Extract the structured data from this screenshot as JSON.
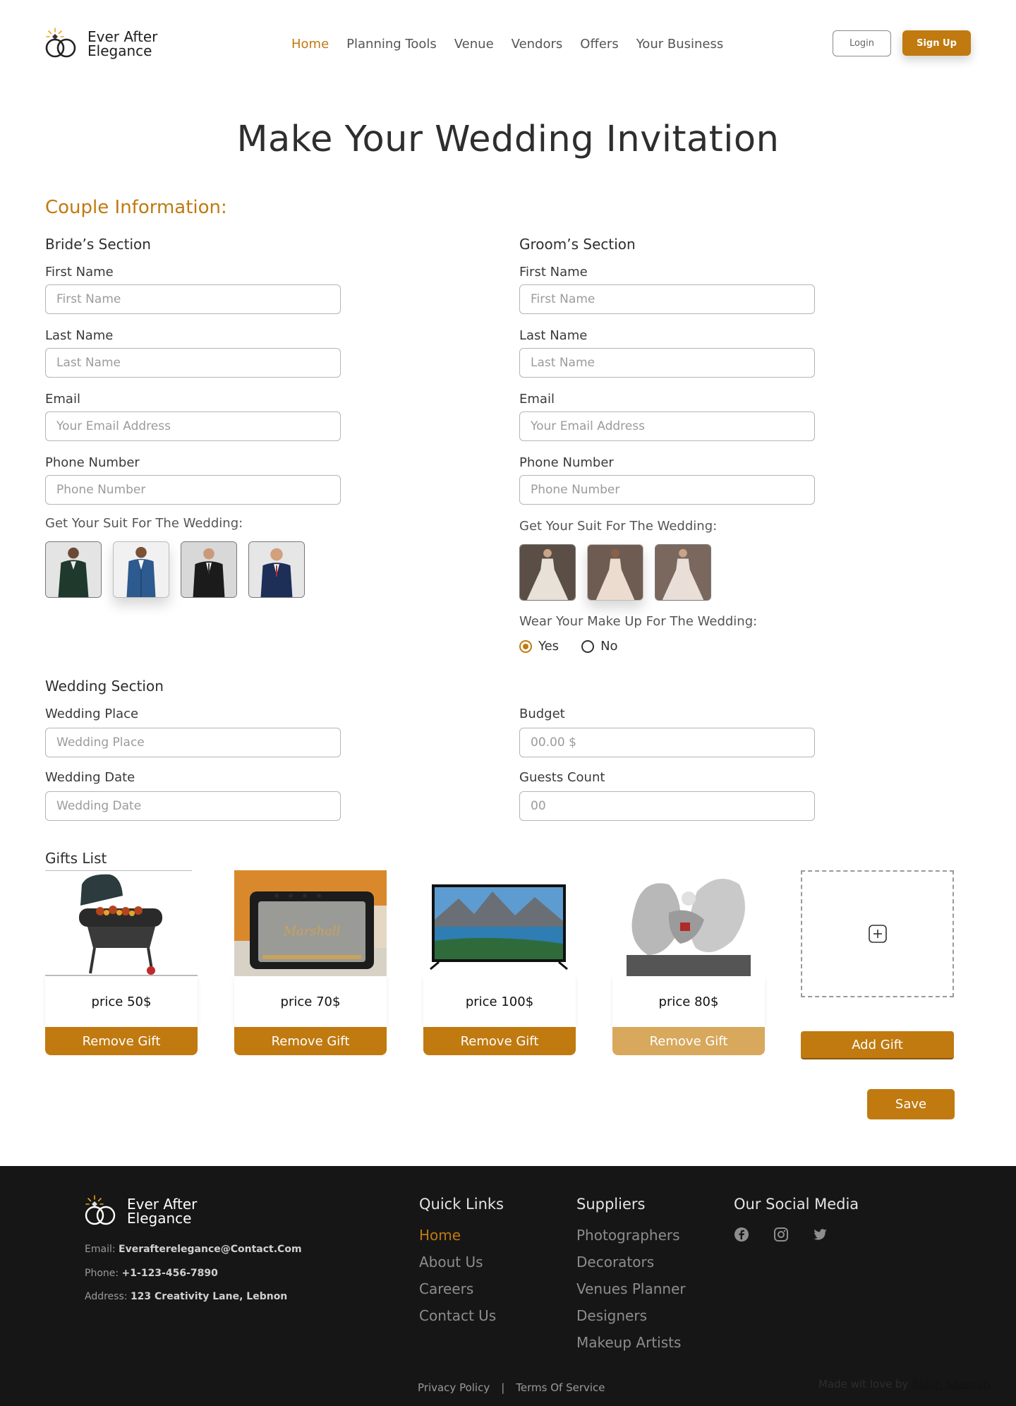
{
  "brand": {
    "line1": "Ever After",
    "line2": "Elegance"
  },
  "nav": {
    "items": [
      "Home",
      "Planning Tools",
      "Venue",
      "Vendors",
      "Offers",
      "Your Business"
    ],
    "active": "Home"
  },
  "auth": {
    "login": "Login",
    "signup": "Sign Up"
  },
  "page_title": "Make Your Wedding Invitation",
  "couple": {
    "heading": "Couple Information:",
    "bride": {
      "title": "Bride’s Section",
      "first_name_label": "First Name",
      "first_name_placeholder": "First Name",
      "last_name_label": "Last Name",
      "last_name_placeholder": "Last Name",
      "email_label": "Email",
      "email_placeholder": "Your Email Address",
      "phone_label": "Phone Number",
      "phone_placeholder": "Phone Number",
      "suit_label": "Get Your Suit For The Wedding:",
      "suits": [
        "suit-green",
        "suit-blue",
        "suit-black",
        "suit-navy"
      ],
      "selected_suit": 1
    },
    "groom": {
      "title": "Groom’s Section",
      "first_name_label": "First Name",
      "first_name_placeholder": "First Name",
      "last_name_label": "Last Name",
      "last_name_placeholder": "Last Name",
      "email_label": "Email",
      "email_placeholder": "Your Email Address",
      "phone_label": "Phone Number",
      "phone_placeholder": "Phone Number",
      "suit_label": "Get Your Suit For The Wedding:",
      "dresses": [
        "dress-1",
        "dress-2",
        "dress-3"
      ],
      "selected_dress": 1,
      "makeup_label": "Wear Your Make Up For The Wedding:",
      "makeup_yes": "Yes",
      "makeup_no": "No",
      "makeup_value": "Yes"
    }
  },
  "wedding": {
    "title": "Wedding Section",
    "place_label": "Wedding Place",
    "place_placeholder": "Wedding Place",
    "date_label": "Wedding Date",
    "date_placeholder": "Wedding Date",
    "budget_label": "Budget",
    "budget_placeholder": "00.00 $",
    "guests_label": "Guests Count",
    "guests_placeholder": "00"
  },
  "gifts": {
    "title": "Gifts List",
    "items": [
      {
        "icon": "grill",
        "price": "price 50$",
        "action": "Remove Gift"
      },
      {
        "icon": "speaker",
        "price": "price 70$",
        "action": "Remove Gift"
      },
      {
        "icon": "tv",
        "price": "price 100$",
        "action": "Remove Gift"
      },
      {
        "icon": "sculpture",
        "price": "price 80$",
        "action": "Remove Gift"
      }
    ],
    "add_label": "Add Gift"
  },
  "save_label": "Save",
  "footer": {
    "email_label": "Email:",
    "email": "Everafterelegance@Contact.Com",
    "phone_label": "Phone:",
    "phone": "+1-123-456-7890",
    "address_label": "Address:",
    "address": "123 Creativity Lane, Lebnon",
    "quick_links_title": "Quick Links",
    "quick_links": [
      "Home",
      "About Us",
      "Careers",
      "Contact Us"
    ],
    "suppliers_title": "Suppliers",
    "suppliers": [
      "Photographers",
      "Decorators",
      "Venues Planner",
      "Designers",
      "Makeup Artists"
    ],
    "social_title": "Our Social Media",
    "socials": [
      "facebook-icon",
      "instagram-icon",
      "twitter-icon"
    ],
    "privacy": "Privacy Policy",
    "separator": "|",
    "terms": "Terms Of Service",
    "made_with": "Made wit love by",
    "author": "Rabih Saasouh"
  },
  "colors": {
    "accent": "#c07a10",
    "accent_light": "#d8a85c",
    "footer_bg": "#161616"
  }
}
